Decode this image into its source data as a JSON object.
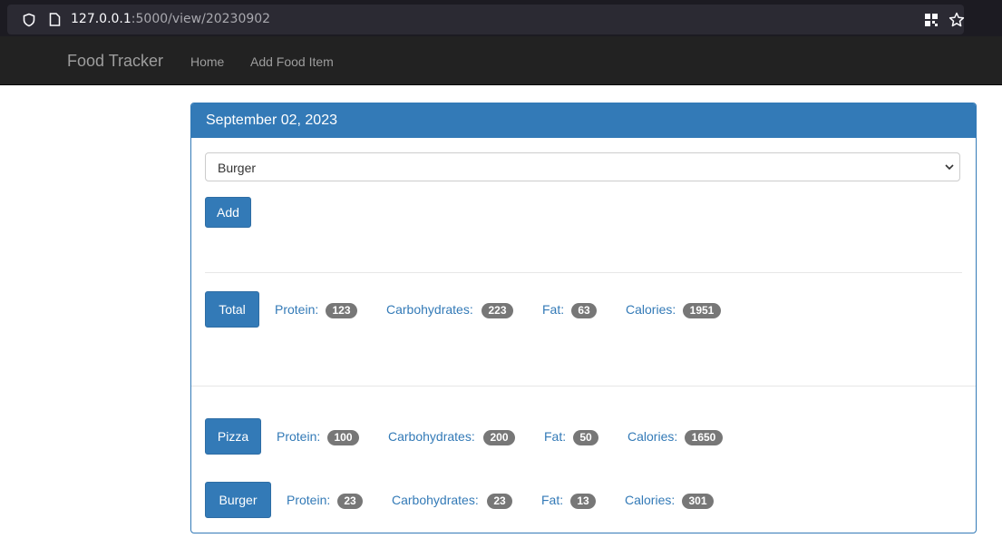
{
  "browser": {
    "url_host": "127.0.0.1",
    "url_path": ":5000/view/20230902"
  },
  "nav": {
    "brand": "Food Tracker",
    "links": [
      "Home",
      "Add Food Item"
    ]
  },
  "panel": {
    "heading": "September 02, 2023",
    "select_value": "Burger",
    "add_label": "Add"
  },
  "total": {
    "label": "Total",
    "protein_label": "Protein:",
    "protein": "123",
    "carbs_label": "Carbohydrates:",
    "carbs": "223",
    "fat_label": "Fat:",
    "fat": "63",
    "calories_label": "Calories:",
    "calories": "1951"
  },
  "foods": [
    {
      "name": "Pizza",
      "protein_label": "Protein:",
      "protein": "100",
      "carbs_label": "Carbohydrates:",
      "carbs": "200",
      "fat_label": "Fat:",
      "fat": "50",
      "calories_label": "Calories:",
      "calories": "1650"
    },
    {
      "name": "Burger",
      "protein_label": "Protein:",
      "protein": "23",
      "carbs_label": "Carbohydrates:",
      "carbs": "23",
      "fat_label": "Fat:",
      "fat": "13",
      "calories_label": "Calories:",
      "calories": "301"
    }
  ]
}
